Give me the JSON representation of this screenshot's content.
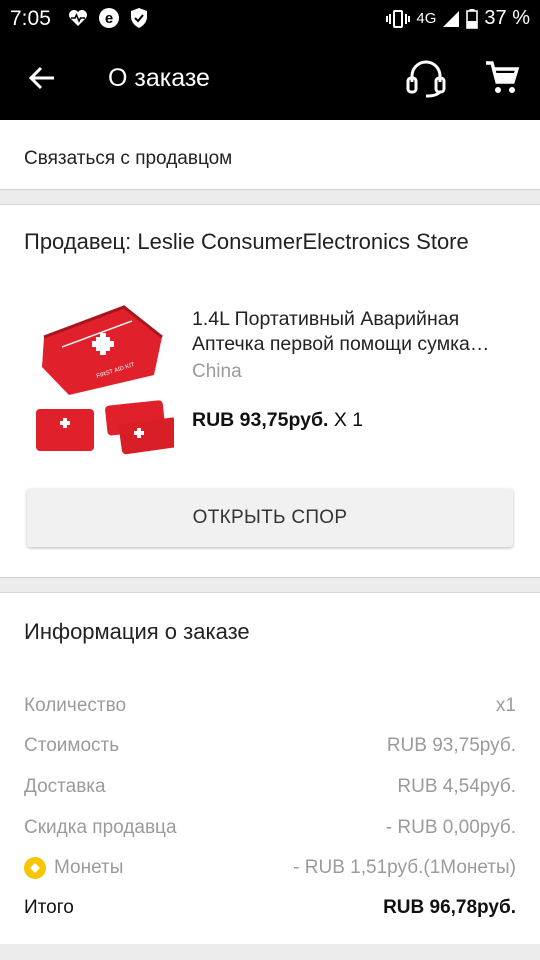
{
  "status_bar": {
    "time": "7:05",
    "network": "4G",
    "battery": "37 %",
    "icons": [
      "heart-pulse-icon",
      "e-badge-icon",
      "shield-icon",
      "vibrate-icon",
      "signal-icon",
      "battery-icon"
    ]
  },
  "app_bar": {
    "title": "О заказе",
    "icons": [
      "back-arrow-icon",
      "support-headset-icon",
      "cart-icon"
    ]
  },
  "contact": {
    "label": "Связаться с продавцом"
  },
  "seller": {
    "label": "Продавец: Leslie ConsumerElectronics Store"
  },
  "product": {
    "name_line1": "1.4L Портативный Аварийная",
    "name_line2": "Аптечка первой помощи сумка…",
    "origin": "China",
    "price": "RUB 93,75руб.",
    "qty": "X 1",
    "image_text": "FIRST AID KIT"
  },
  "dispute": {
    "label": "ОТКРЫТЬ СПОР"
  },
  "order_info": {
    "title": "Информация о заказе",
    "rows": [
      {
        "label": "Количество",
        "value": "x1"
      },
      {
        "label": "Стоимость",
        "value": "RUB 93,75руб."
      },
      {
        "label": "Доставка",
        "value": "RUB 4,54руб."
      },
      {
        "label": "Скидка продавца",
        "value": "- RUB 0,00руб."
      },
      {
        "label": "Монеты",
        "value": "- RUB 1,51руб.(1Монеты)"
      }
    ],
    "total": {
      "label": "Итого",
      "value": "RUB 96,78руб."
    }
  },
  "colors": {
    "bar": "#000000",
    "coin": "#f7c600",
    "product_red": "#e0202a",
    "muted": "#9b9b9b"
  }
}
